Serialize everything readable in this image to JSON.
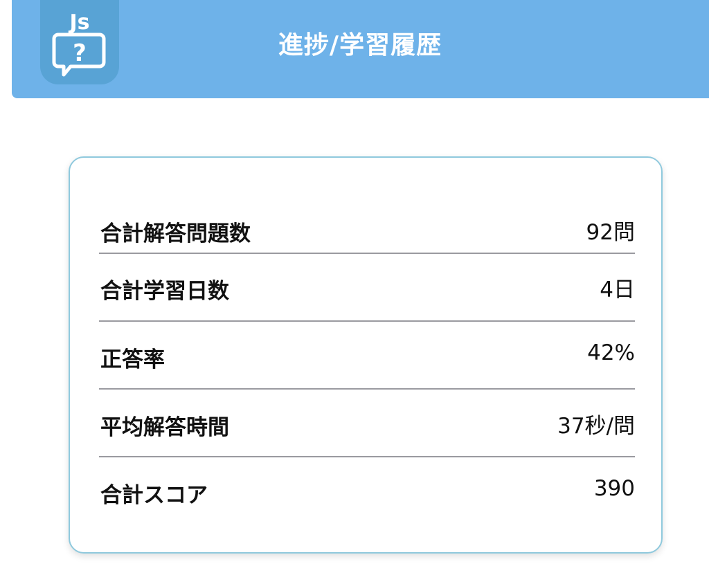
{
  "header": {
    "title": "進捗/学習履歴",
    "app_icon": {
      "name": "js-quiz-icon",
      "text": "Js",
      "symbol": "?"
    },
    "background_color": "#6eb2e9"
  },
  "stats": {
    "rows": [
      {
        "label": "合計解答問題数",
        "value": "92問"
      },
      {
        "label": "合計学習日数",
        "value": "4日"
      },
      {
        "label": "正答率",
        "value": "42%"
      },
      {
        "label": "平均解答時間",
        "value": "37秒/問"
      },
      {
        "label": "合計スコア",
        "value": "390"
      }
    ]
  },
  "colors": {
    "accent": "#6eb2e9",
    "card_border": "#8fc9dd",
    "divider": "#9a9aa0",
    "text": "#111111"
  }
}
